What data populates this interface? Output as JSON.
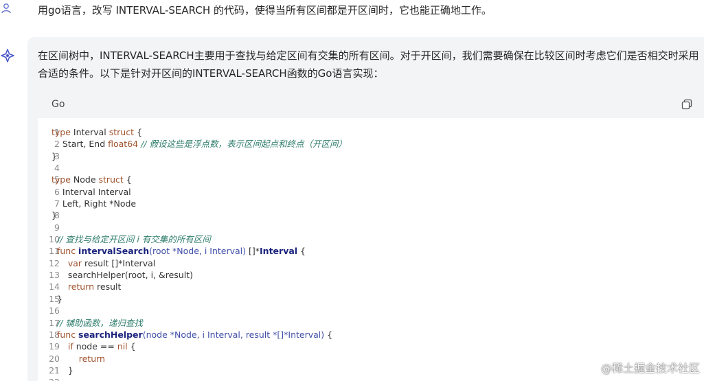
{
  "user_message": {
    "avatar_icon": "user-icon",
    "text": "用go语言，改写 INTERVAL-SEARCH 的代码，使得当所有区间都是开区间时，它也能正确地工作。"
  },
  "ai_message": {
    "avatar_icon": "ai-logo-icon",
    "text": "在区间树中，INTERVAL-SEARCH主要用于查找与给定区间有交集的所有区间。对于开区间，我们需要确保在比较区间时考虑它们是否相交时采用合适的条件。以下是针对开区间的INTERVAL-SEARCH函数的Go语言实现："
  },
  "code_block": {
    "language": "Go",
    "copy_icon": "copy-icon",
    "lines": [
      [
        {
          "t": "type ",
          "c": "kw"
        },
        {
          "t": "Interval ",
          "c": ""
        },
        {
          "t": "struct",
          "c": "kw"
        },
        {
          "t": " {",
          "c": ""
        }
      ],
      [
        {
          "t": "    Start, End ",
          "c": ""
        },
        {
          "t": "float64",
          "c": "kw"
        },
        {
          "t": " ",
          "c": ""
        },
        {
          "t": "// 假设这些是浮点数，表示区间起点和终点（开区间）",
          "c": "cm"
        }
      ],
      [
        {
          "t": "}",
          "c": ""
        }
      ],
      [],
      [
        {
          "t": "type ",
          "c": "kw"
        },
        {
          "t": "Node ",
          "c": ""
        },
        {
          "t": "struct",
          "c": "kw"
        },
        {
          "t": " {",
          "c": ""
        }
      ],
      [
        {
          "t": "    Interval Interval",
          "c": ""
        }
      ],
      [
        {
          "t": "    Left, Right *Node",
          "c": ""
        }
      ],
      [
        {
          "t": "}",
          "c": ""
        }
      ],
      [],
      [
        {
          "t": "  ",
          "c": ""
        },
        {
          "t": "// 查找与给定开区间 i 有交集的所有区间",
          "c": "cm"
        }
      ],
      [
        {
          "t": "  ",
          "c": ""
        },
        {
          "t": "func ",
          "c": "kw"
        },
        {
          "t": "intervalSearch",
          "c": "fn"
        },
        {
          "t": "(root *Node, i Interval)",
          "c": "ty"
        },
        {
          "t": " []*",
          "c": ""
        },
        {
          "t": "Interval",
          "c": "fn"
        },
        {
          "t": " {",
          "c": ""
        }
      ],
      [
        {
          "t": "      ",
          "c": ""
        },
        {
          "t": "var",
          "c": "kw"
        },
        {
          "t": " result []*Interval",
          "c": ""
        }
      ],
      [
        {
          "t": "      searchHelper(root, i, &result)",
          "c": ""
        }
      ],
      [
        {
          "t": "      ",
          "c": ""
        },
        {
          "t": "return",
          "c": "kw"
        },
        {
          "t": " result",
          "c": ""
        }
      ],
      [
        {
          "t": "  }",
          "c": ""
        }
      ],
      [],
      [
        {
          "t": "  ",
          "c": ""
        },
        {
          "t": "// 辅助函数，递归查找",
          "c": "cm"
        }
      ],
      [
        {
          "t": "  ",
          "c": ""
        },
        {
          "t": "func ",
          "c": "kw"
        },
        {
          "t": "searchHelper",
          "c": "fn"
        },
        {
          "t": "(node *Node, i Interval, result *[]*Interval)",
          "c": "ty"
        },
        {
          "t": " {",
          "c": ""
        }
      ],
      [
        {
          "t": "      ",
          "c": ""
        },
        {
          "t": "if",
          "c": "kw"
        },
        {
          "t": " node == ",
          "c": ""
        },
        {
          "t": "nil",
          "c": "kw"
        },
        {
          "t": " {",
          "c": ""
        }
      ],
      [
        {
          "t": "          ",
          "c": ""
        },
        {
          "t": "return",
          "c": "kw"
        }
      ],
      [
        {
          "t": "      }",
          "c": ""
        }
      ],
      []
    ]
  },
  "watermark": "@稀土掘金技术社区"
}
